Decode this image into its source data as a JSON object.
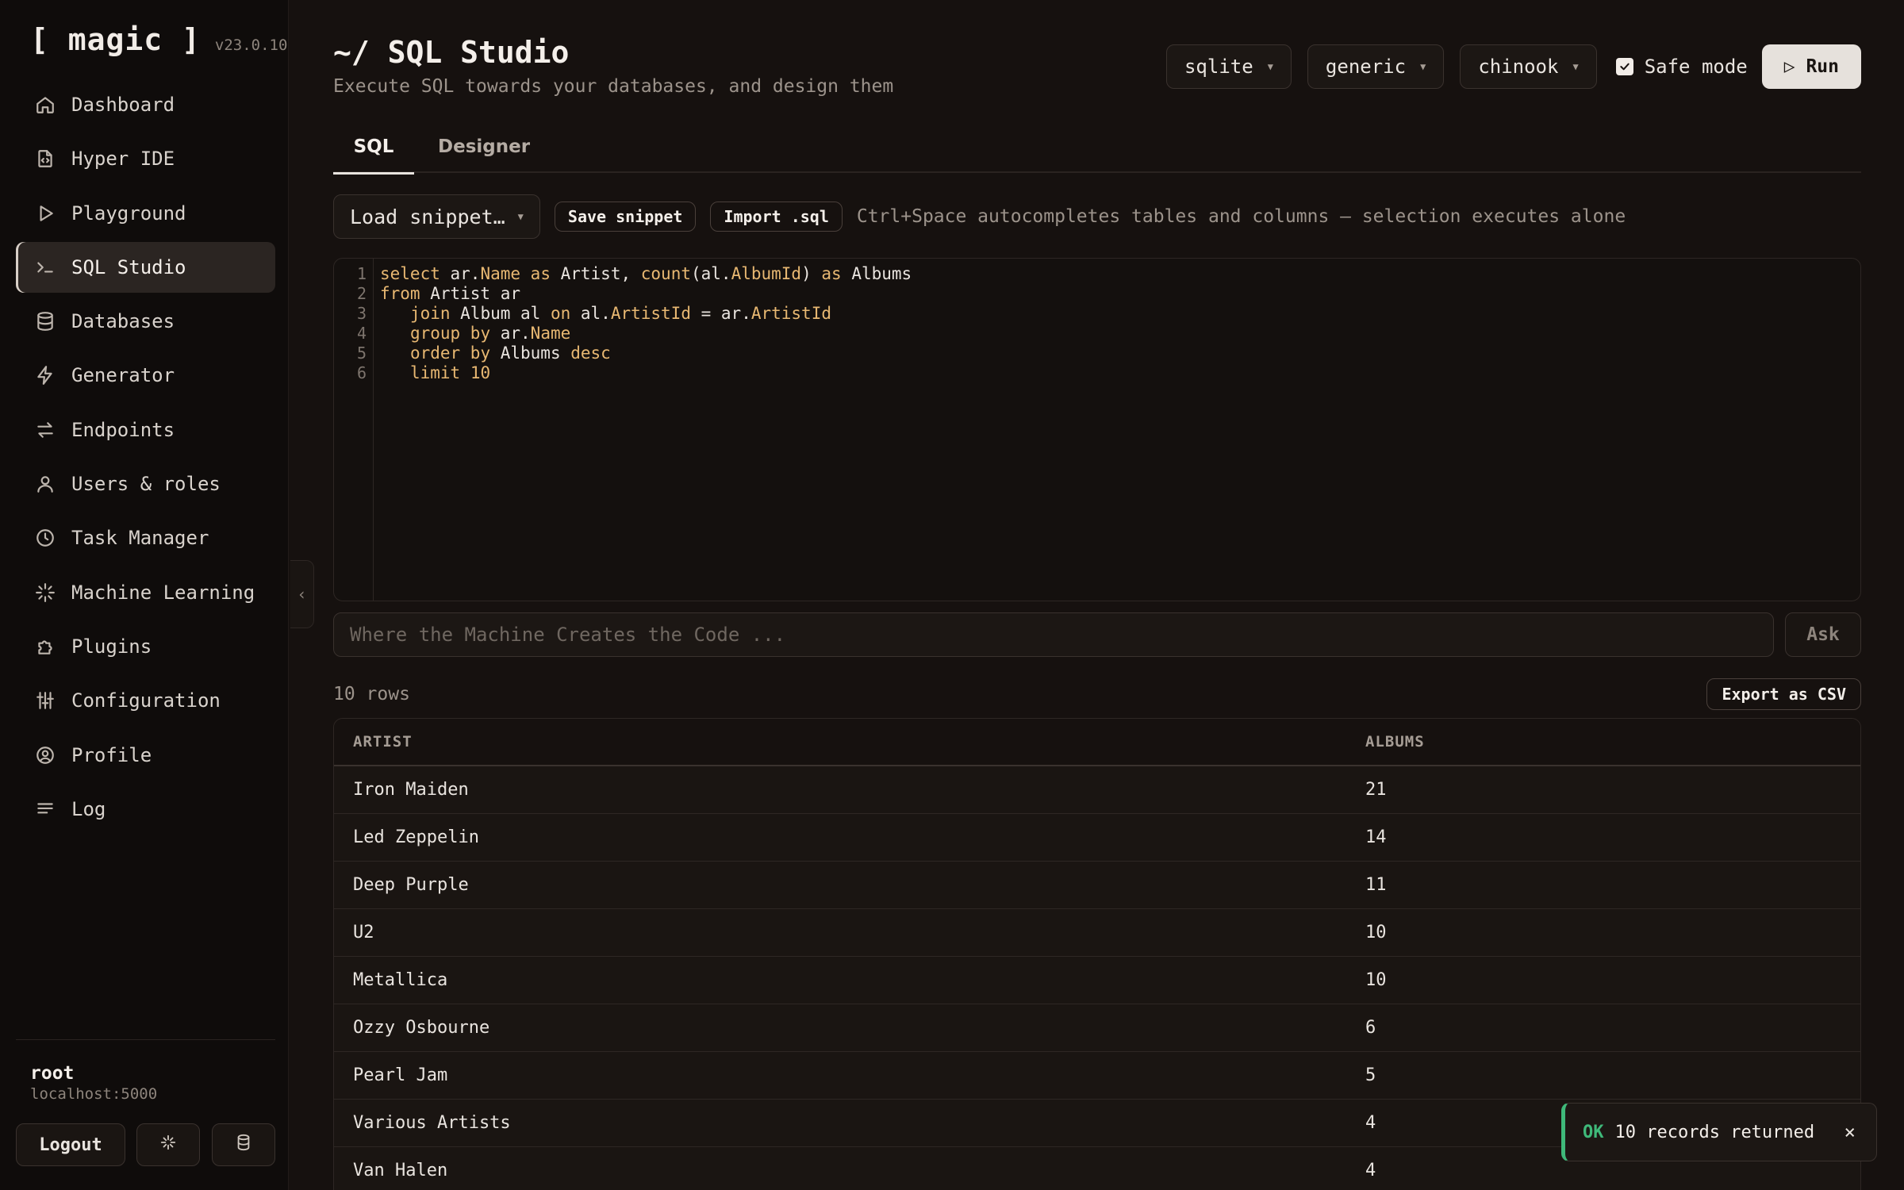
{
  "sidebar": {
    "brand": "[ magic ]",
    "version": "v23.0.10",
    "items": [
      {
        "label": "Dashboard",
        "icon": "home-icon"
      },
      {
        "label": "Hyper IDE",
        "icon": "file-code-icon"
      },
      {
        "label": "Playground",
        "icon": "play-icon"
      },
      {
        "label": "SQL Studio",
        "icon": "terminal-icon",
        "active": true
      },
      {
        "label": "Databases",
        "icon": "database-icon"
      },
      {
        "label": "Generator",
        "icon": "bolt-icon"
      },
      {
        "label": "Endpoints",
        "icon": "arrows-icon"
      },
      {
        "label": "Users & roles",
        "icon": "user-icon"
      },
      {
        "label": "Task Manager",
        "icon": "clock-icon"
      },
      {
        "label": "Machine Learning",
        "icon": "sparkle-icon"
      },
      {
        "label": "Plugins",
        "icon": "puzzle-icon"
      },
      {
        "label": "Configuration",
        "icon": "sliders-icon"
      },
      {
        "label": "Profile",
        "icon": "user-circle-icon"
      },
      {
        "label": "Log",
        "icon": "list-icon"
      }
    ],
    "user": {
      "name": "root",
      "host": "localhost:5000"
    },
    "logout_label": "Logout"
  },
  "header": {
    "title": "~/ SQL Studio",
    "subtitle": "Execute SQL towards your databases, and design them",
    "db_type": "sqlite",
    "connection": "generic",
    "database": "chinook",
    "safe_mode_label": "Safe mode",
    "safe_mode_checked": true,
    "run_label": "▷ Run"
  },
  "tabs": [
    {
      "label": "SQL",
      "active": true
    },
    {
      "label": "Designer",
      "active": false
    }
  ],
  "toolbar": {
    "load_snippet_label": "Load snippet…",
    "save_snippet_label": "Save snippet",
    "import_label": "Import .sql",
    "hint": "Ctrl+Space autocompletes tables and columns — selection executes alone"
  },
  "editor": {
    "line_numbers": [
      "1",
      "2",
      "3",
      "4",
      "5",
      "6"
    ]
  },
  "ask": {
    "placeholder": "Where the Machine Creates the Code ...",
    "button_label": "Ask"
  },
  "results": {
    "row_count": "10 rows",
    "export_label": "Export as CSV",
    "columns": [
      "ARTIST",
      "ALBUMS"
    ],
    "rows": [
      [
        "Iron Maiden",
        "21"
      ],
      [
        "Led Zeppelin",
        "14"
      ],
      [
        "Deep Purple",
        "11"
      ],
      [
        "U2",
        "10"
      ],
      [
        "Metallica",
        "10"
      ],
      [
        "Ozzy Osbourne",
        "6"
      ],
      [
        "Pearl Jam",
        "5"
      ],
      [
        "Various Artists",
        "4"
      ],
      [
        "Van Halen",
        "4"
      ]
    ]
  },
  "toast": {
    "status": "OK",
    "message": "10 records returned",
    "close": "×"
  },
  "colors": {
    "background": "#16110f",
    "accent_code": "#e8b872",
    "ok": "#3fb97a"
  }
}
